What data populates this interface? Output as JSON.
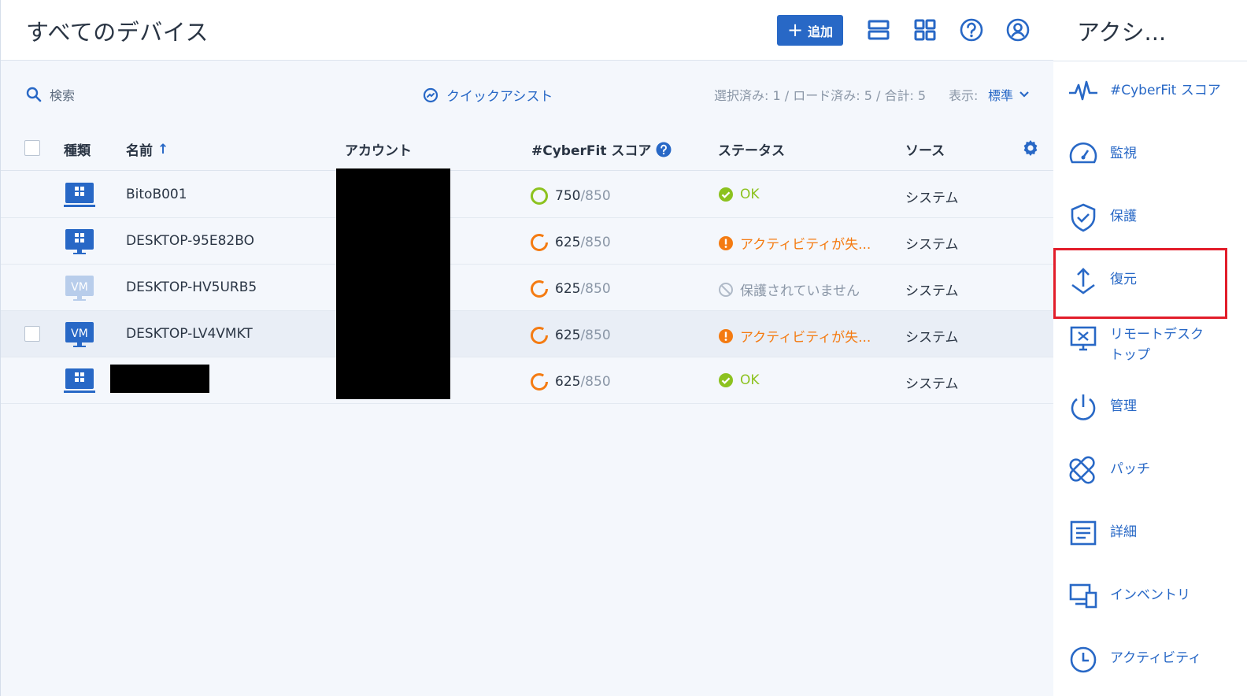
{
  "header": {
    "title": "すべてのデバイス",
    "add_label": "追加",
    "add_plus": "+"
  },
  "toolbar": {
    "search_placeholder": "検索",
    "quick_assist": "クイックアシスト",
    "counts": "選択済み: 1 / ロード済み: 5 / 合計: 5",
    "view_label": "表示:",
    "view_value": "標準"
  },
  "table": {
    "columns": [
      "種類",
      "名前",
      "アカウント",
      "#CyberFit スコア",
      "ステータス",
      "ソース"
    ],
    "sort_arrow": "↑",
    "rows": [
      {
        "type": "workstation",
        "name": "BitoB001",
        "score": "750",
        "max": "/850",
        "status": "OK",
        "status_kind": "ok",
        "source": "システム"
      },
      {
        "type": "desktop",
        "name": "DESKTOP-95E82BO",
        "score": "625",
        "max": "/850",
        "status": "アクティビティが失...",
        "status_kind": "warn",
        "source": "システム"
      },
      {
        "type": "vm-disabled",
        "name": "DESKTOP-HV5URB5",
        "score": "625",
        "max": "/850",
        "status": "保護されていません",
        "status_kind": "none",
        "source": "システム"
      },
      {
        "type": "vm",
        "name": "DESKTOP-LV4VMKT",
        "score": "625",
        "max": "/850",
        "status": "アクティビティが失...",
        "status_kind": "warn",
        "source": "システム"
      },
      {
        "type": "workstation",
        "name": "",
        "score": "625",
        "max": "/850",
        "status": "OK",
        "status_kind": "ok",
        "source": "システム"
      }
    ],
    "vm_label": "VM"
  },
  "actions": {
    "title": "アクシ...",
    "items": [
      {
        "icon": "pulse-icon",
        "label": "#CyberFit スコア"
      },
      {
        "icon": "gauge-icon",
        "label": "監視"
      },
      {
        "icon": "shield-icon",
        "label": "保護"
      },
      {
        "icon": "recovery-icon",
        "label": "復元"
      },
      {
        "icon": "remote-desktop-icon",
        "label": "リモートデスク\nトップ"
      },
      {
        "icon": "power-icon",
        "label": "管理"
      },
      {
        "icon": "patch-icon",
        "label": "パッチ"
      },
      {
        "icon": "details-icon",
        "label": "詳細"
      },
      {
        "icon": "inventory-icon",
        "label": "インベントリ"
      },
      {
        "icon": "clock-icon",
        "label": "アクティビティ"
      }
    ]
  },
  "colors": {
    "accent": "#2868c6",
    "ok": "#8cc21f",
    "warn": "#f47b12",
    "highlight": "#e21d2a"
  }
}
